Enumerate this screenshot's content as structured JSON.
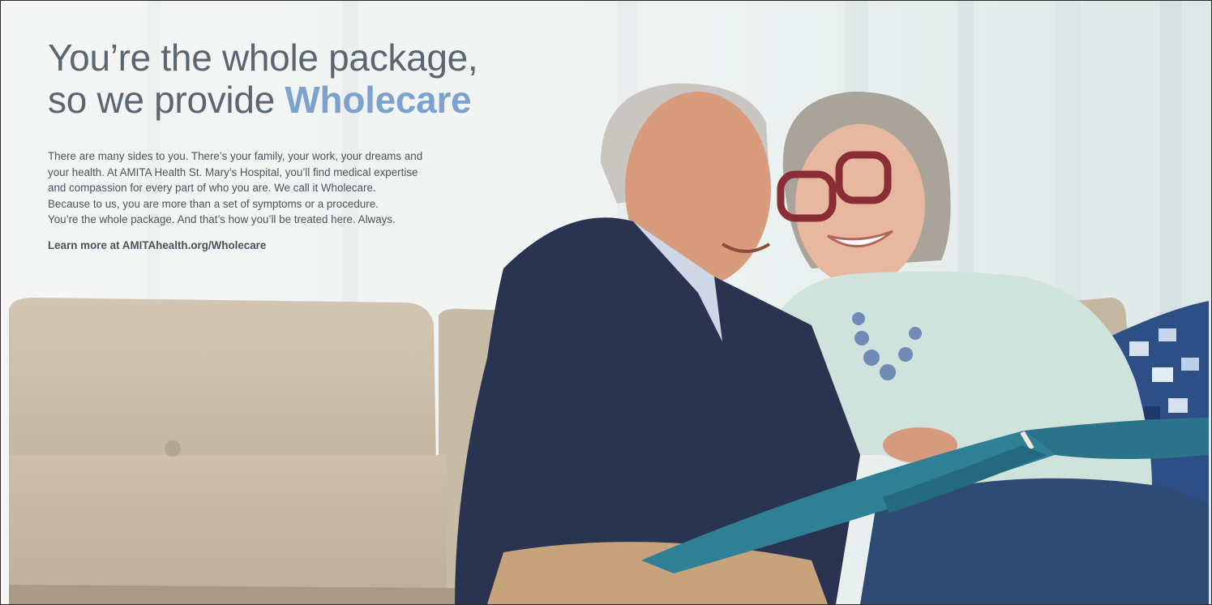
{
  "ad": {
    "headline_line1": "You’re the whole package,",
    "headline_line2_prefix": "so we provide ",
    "headline_accent": "Wholecare",
    "body_lines": [
      "There are many sides to you. There’s your family, your work, your dreams and",
      "your health. At AMITA Health St. Mary’s Hospital, you’ll find medical expertise",
      "and compassion for every part of who you are. We call it Wholecare.",
      "Because to us, you are more than a set of symptoms or a procedure.",
      "You’re the whole package. And that’s how you’ll be treated here. Always."
    ],
    "cta": "Learn more at AMITAhealth.org/Wholecare"
  },
  "colors": {
    "headline_text": "#5b6770",
    "accent": "#7ea2cf",
    "body_text": "#4a545c",
    "sofa": "#c9bba6",
    "sweater_navy": "#2a3350",
    "sweater_mint": "#cfe3dc",
    "album_teal": "#2f7f95"
  }
}
